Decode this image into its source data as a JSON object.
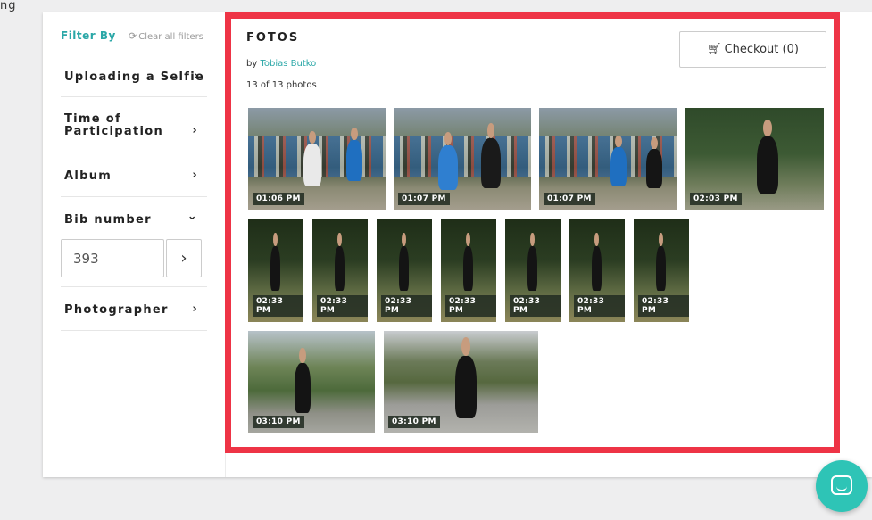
{
  "top_fragment": "ng",
  "sidebar": {
    "filter_by": "Filter By",
    "clear_all": "Clear all filters",
    "items": [
      {
        "label": "Uploading a Selfie",
        "chevron": "›"
      },
      {
        "label": "Time of Participation",
        "chevron": "›"
      },
      {
        "label": "Album",
        "chevron": "›"
      },
      {
        "label": "Bib number",
        "chevron": "⌄"
      },
      {
        "label": "Photographer",
        "chevron": "›"
      }
    ],
    "bib_value": "393",
    "bib_go": "›"
  },
  "gallery": {
    "title": "FOTOS",
    "by_prefix": "by",
    "author": "Tobias Butko",
    "count": "13 of 13 photos"
  },
  "checkout": {
    "label": "Checkout (0)"
  },
  "photos": [
    {
      "time": "01:06 PM",
      "scene": "crowd"
    },
    {
      "time": "01:07 PM",
      "scene": "crowd"
    },
    {
      "time": "01:07 PM",
      "scene": "crowd"
    },
    {
      "time": "02:03 PM",
      "scene": "forest"
    },
    {
      "time": "02:33 PM",
      "scene": "grass"
    },
    {
      "time": "02:33 PM",
      "scene": "grass"
    },
    {
      "time": "02:33 PM",
      "scene": "grass"
    },
    {
      "time": "02:33 PM",
      "scene": "grass"
    },
    {
      "time": "02:33 PM",
      "scene": "grass"
    },
    {
      "time": "02:33 PM",
      "scene": "grass"
    },
    {
      "time": "02:33 PM",
      "scene": "grass"
    },
    {
      "time": "03:10 PM",
      "scene": "hill"
    },
    {
      "time": "03:10 PM",
      "scene": "road"
    }
  ],
  "icons": {
    "refresh": "refresh-icon",
    "cart": "cart-icon",
    "chat": "chat-icon"
  },
  "colors": {
    "accent": "#2aa7a7",
    "highlight_frame": "#ee3446",
    "chat": "#2ec4b6"
  }
}
